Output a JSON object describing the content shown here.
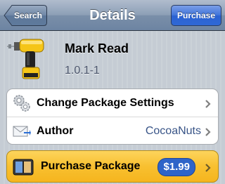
{
  "navbar": {
    "back_label": "Search",
    "title": "Details",
    "action_label": "Purchase"
  },
  "package": {
    "name": "Mark Read",
    "version": "1.0.1-1",
    "icon": "drill-icon"
  },
  "rows": [
    {
      "label": "Change Package Settings",
      "value": "",
      "icon": "gears-icon"
    },
    {
      "label": "Author",
      "value": "CocoaNuts",
      "icon": "mail-icon"
    }
  ],
  "purchase": {
    "label": "Purchase Package",
    "price": "$1.99",
    "icon": "ibooks-icon"
  },
  "colors": {
    "nav_top": "#b0bccd",
    "nav_bottom": "#6d84a2",
    "action_blue": "#2f68d6",
    "purchase_gold": "#f8c030",
    "value_blue": "#385487"
  }
}
